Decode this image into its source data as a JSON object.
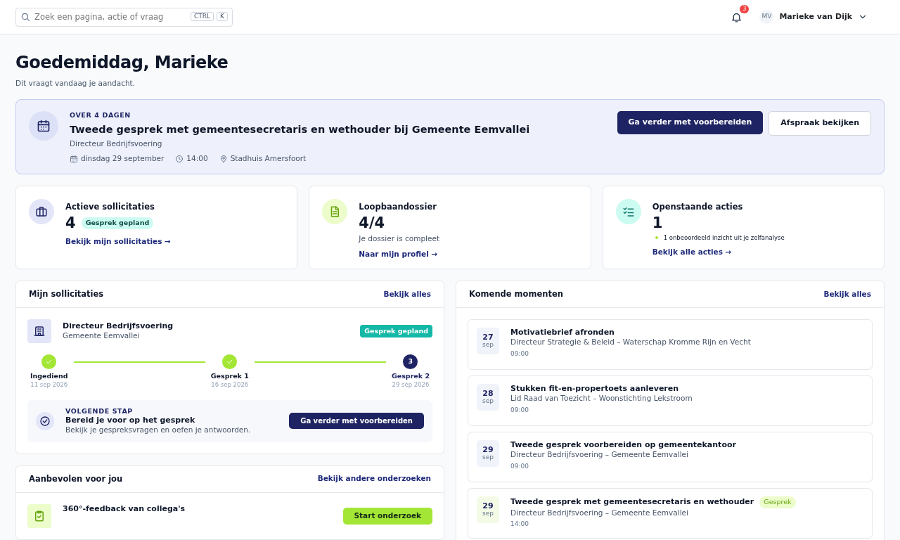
{
  "topbar": {
    "search": {
      "placeholder": "Zoek een pagina, actie of vraag",
      "keys": [
        "CTRL",
        "K"
      ]
    },
    "notifications": "3",
    "user": {
      "initials": "MV",
      "name": "Marieke van Dijk"
    }
  },
  "greeting": {
    "title": "Goedemiddag, Marieke",
    "subtitle": "Dit vraagt vandaag je aandacht."
  },
  "highlight": {
    "eyebrow": "OVER 4 DAGEN",
    "title": "Tweede gesprek met gemeentesecretaris en wethouder bij Gemeente Eemvallei",
    "role": "Directeur Bedrijfsvoering",
    "date": "dinsdag 29 september",
    "time": "14:00",
    "location": "Stadhuis Amersfoort",
    "primary_button": "Ga verder met voorbereiden",
    "secondary_button": "Afspraak bekijken"
  },
  "stats": [
    {
      "kind": "briefcase",
      "title": "Actieve sollicitaties",
      "value": "4",
      "badge": "Gesprek gepland",
      "link": "Bekijk mijn sollicitaties →"
    },
    {
      "kind": "document",
      "title": "Loopbaandossier",
      "value": "4/4",
      "note": "Je dossier is compleet",
      "link": "Naar mijn profiel →"
    },
    {
      "kind": "checklist",
      "title": "Openstaande acties",
      "value": "1",
      "bullets": [
        "1 onbeoordeeld inzicht uit je zelfanalyse"
      ],
      "link": "Bekijk alle acties →"
    }
  ],
  "applications": {
    "title": "Mijn sollicitaties",
    "link": "Bekijk alles",
    "item": {
      "role": "Directeur Bedrijfsvoering",
      "org": "Gemeente Eemvallei",
      "status": "Gesprek gepland",
      "steps": [
        {
          "label": "Ingediend",
          "date": "11 sep 2026",
          "done": true
        },
        {
          "label": "Gesprek 1",
          "date": "16 sep 2026",
          "done": true
        },
        {
          "label": "Gesprek 2",
          "date": "29 sep 2026",
          "done": false,
          "number": "3"
        }
      ],
      "next": {
        "eyebrow": "VOLGENDE STAP",
        "title": "Bereid je voor op het gesprek",
        "text": "Bekijk je gespreksvragen en oefen je antwoorden.",
        "button": "Ga verder met voorbereiden"
      }
    }
  },
  "recommended": {
    "title": "Aanbevolen voor jou",
    "link": "Bekijk andere onderzoeken",
    "items": [
      {
        "title": "360°-feedback van collega's",
        "button": "Start onderzoek"
      }
    ]
  },
  "upcoming": {
    "title": "Komende momenten",
    "link": "Bekijk alles",
    "items": [
      {
        "kind": "task",
        "day": "27",
        "month": "sep",
        "title": "Motivatiebrief afronden",
        "sub": "Directeur Strategie & Beleid – Waterschap Kromme Rijn en Vecht",
        "time": "09:00"
      },
      {
        "kind": "task",
        "day": "28",
        "month": "sep",
        "title": "Stukken fit-en-propertoets aanleveren",
        "sub": "Lid Raad van Toezicht – Woonstichting Lekstroom",
        "time": "09:00"
      },
      {
        "kind": "task",
        "day": "29",
        "month": "sep",
        "title": "Tweede gesprek voorbereiden op gemeentekantoor",
        "sub": "Directeur Bedrijfsvoering – Gemeente Eemvallei",
        "time": "09:00"
      },
      {
        "kind": "interview",
        "day": "29",
        "month": "sep",
        "title": "Tweede gesprek met gemeentesecretaris en wethouder",
        "tag": "Gesprek",
        "sub": "Directeur Bedrijfsvoering – Gemeente Eemvallei",
        "time": "14:00"
      }
    ]
  }
}
